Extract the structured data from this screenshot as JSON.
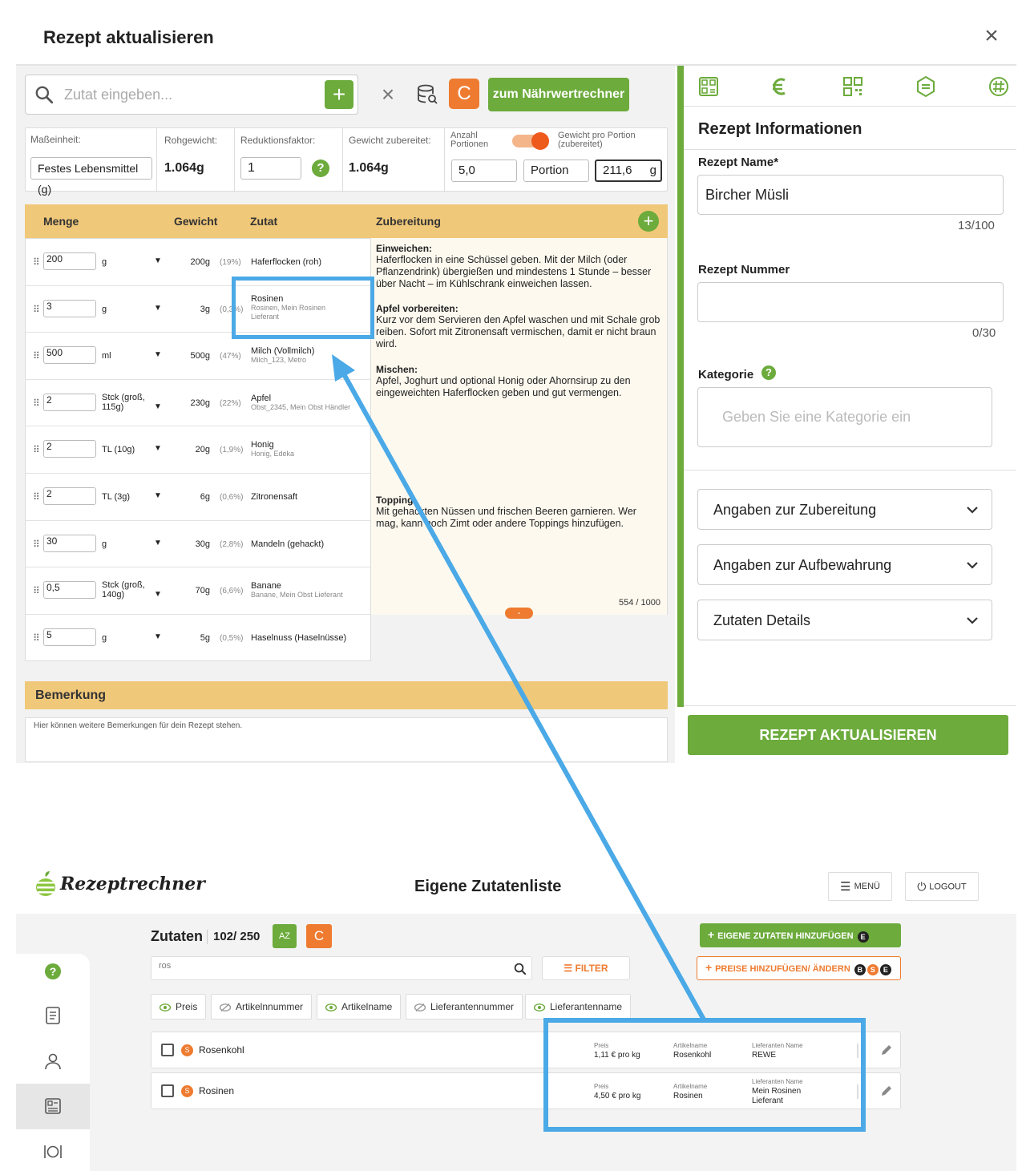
{
  "modal": {
    "title": "Rezept aktualisieren",
    "close": "×",
    "search_placeholder": "Zutat eingeben...",
    "add": "+",
    "clear": "×",
    "refresh": "C",
    "calc_button": "zum Nährwertrechner"
  },
  "params": {
    "unit_label": "Maßeinheit:",
    "unit_value": "Festes Lebensmittel (g)",
    "raw_label": "Rohgewicht:",
    "raw_value": "1.064g",
    "reduction_label": "Reduktionsfaktor:",
    "reduction_value": "1",
    "help": "?",
    "cooked_label": "Gewicht zubereitet:",
    "cooked_value": "1.064g",
    "portions_label": "Anzahl Portionen",
    "per_portion_label": "Gewicht pro Portion (zubereitet)",
    "portions_value": "5,0",
    "portion_unit": "Portion",
    "per_portion_value": "211,6",
    "per_portion_unit": "g"
  },
  "table": {
    "headers": {
      "menge": "Menge",
      "gewicht": "Gewicht",
      "zutat": "Zutat",
      "zubereitung": "Zubereitung"
    },
    "add": "+",
    "rows": [
      {
        "qty": "200",
        "unit": "g",
        "weight": "200g",
        "pct": "(19%)",
        "name": "Haferflocken (roh)",
        "sub": ""
      },
      {
        "qty": "3",
        "unit": "g",
        "weight": "3g",
        "pct": "(0,3%)",
        "name": "Rosinen",
        "sub": "Rosinen, Mein Rosinen Lieferant"
      },
      {
        "qty": "500",
        "unit": "ml",
        "weight": "500g",
        "pct": "(47%)",
        "name": "Milch (Vollmilch)",
        "sub": "Milch_123, Metro"
      },
      {
        "qty": "2",
        "unit": "Stck (groß, 115g)",
        "weight": "230g",
        "pct": "(22%)",
        "name": "Apfel",
        "sub": "Obst_2345, Mein Obst Händler"
      },
      {
        "qty": "2",
        "unit": "TL (10g)",
        "weight": "20g",
        "pct": "(1,9%)",
        "name": "Honig",
        "sub": "Honig, Edeka"
      },
      {
        "qty": "2",
        "unit": "TL (3g)",
        "weight": "6g",
        "pct": "(0,6%)",
        "name": "Zitronensaft",
        "sub": ""
      },
      {
        "qty": "30",
        "unit": "g",
        "weight": "30g",
        "pct": "(2,8%)",
        "name": "Mandeln (gehackt)",
        "sub": ""
      },
      {
        "qty": "0,5",
        "unit": "Stck (groß, 140g)",
        "weight": "70g",
        "pct": "(6,6%)",
        "name": "Banane",
        "sub": "Banane, Mein Obst Lieferant"
      },
      {
        "qty": "5",
        "unit": "g",
        "weight": "5g",
        "pct": "(0,5%)",
        "name": "Haselnuss (Haselnüsse)",
        "sub": ""
      }
    ]
  },
  "prep": {
    "h1": "Einweichen:",
    "t1": "Haferflocken in eine Schüssel geben. Mit der Milch (oder Pflanzendrink) übergießen und mindestens 1 Stunde – besser über Nacht – im Kühlschrank einweichen lassen.",
    "h2": "Apfel vorbereiten:",
    "t2": "Kurz vor dem Servieren den Apfel waschen und mit Schale grob reiben. Sofort mit Zitronensaft vermischen, damit er nicht braun wird.",
    "h3": "Mischen:",
    "t3": "Apfel, Joghurt und optional Honig oder Ahornsirup zu den eingeweichten Haferflocken geben und gut vermengen.",
    "h4": "Topping:",
    "t4": "Mit gehackten Nüssen und frischen Beeren garnieren. Wer mag, kann noch Zimt oder andere Toppings hinzufügen.",
    "count": "554 / 1000",
    "collapse": "-"
  },
  "remark": {
    "title": "Bemerkung",
    "placeholder": "Hier können weitere Bemerkungen für dein Rezept stehen."
  },
  "info": {
    "title": "Rezept Informationen",
    "name_label": "Rezept Name*",
    "name_value": "Bircher Müsli",
    "name_count": "13/100",
    "number_label": "Rezept Nummer",
    "number_value": "",
    "number_count": "0/30",
    "category_label": "Kategorie",
    "category_help": "?",
    "category_placeholder": "Geben Sie eine Kategorie ein",
    "accordions": [
      "Angaben zur Zubereitung",
      "Angaben zur Aufbewahrung",
      "Zutaten Details"
    ],
    "update_button": "REZEPT AKTUALISIEREN"
  },
  "app": {
    "logo": "Rezeptrechner",
    "title": "Eigene Zutatenliste",
    "menu": "MENÜ",
    "logout": "LOGOUT",
    "list_title": "Zutaten",
    "list_count": "102/ 250",
    "az": "AZ",
    "refresh": "C",
    "add_own": "EIGENE ZUTATEN HINZUFÜGEN",
    "prices": "PREISE HINZUFÜGEN/ ÄNDERN",
    "badge_b": "B",
    "badge_s": "S",
    "badge_e": "E",
    "search_value": "ros",
    "filter": "FILTER",
    "chips": [
      "Preis",
      "Artikelnnummer",
      "Artikelname",
      "Lieferantennummer",
      "Lieferantenname"
    ],
    "col_labels": {
      "price": "Preis",
      "article": "Artikelname",
      "supplier": "Lieferanten Name"
    },
    "rows": [
      {
        "badge": "S",
        "name": "Rosenkohl",
        "price": "1,11 € pro kg",
        "article": "Rosenkohl",
        "supplier": "REWE"
      },
      {
        "badge": "S",
        "name": "Rosinen",
        "price": "4,50 € pro kg",
        "article": "Rosinen",
        "supplier": "Mein Rosinen Lieferant"
      }
    ]
  },
  "colors": {
    "green": "#6cab3c",
    "orange": "#ee7b30",
    "gold": "#f0c879",
    "highlight": "#4aa9e6"
  },
  "icons": [
    "search-icon",
    "database-icon",
    "nutrition-tab-icon",
    "euro-tab-icon",
    "qr-tab-icon",
    "settings-tab-icon",
    "allergen-tab-icon",
    "chevron-down-icon",
    "logo-apple-icon",
    "menu-icon",
    "power-icon",
    "help-icon",
    "recipe-icon",
    "user-icon",
    "ingredients-icon",
    "dish-icon",
    "eye-icon",
    "eye-off-icon",
    "edit-icon"
  ]
}
